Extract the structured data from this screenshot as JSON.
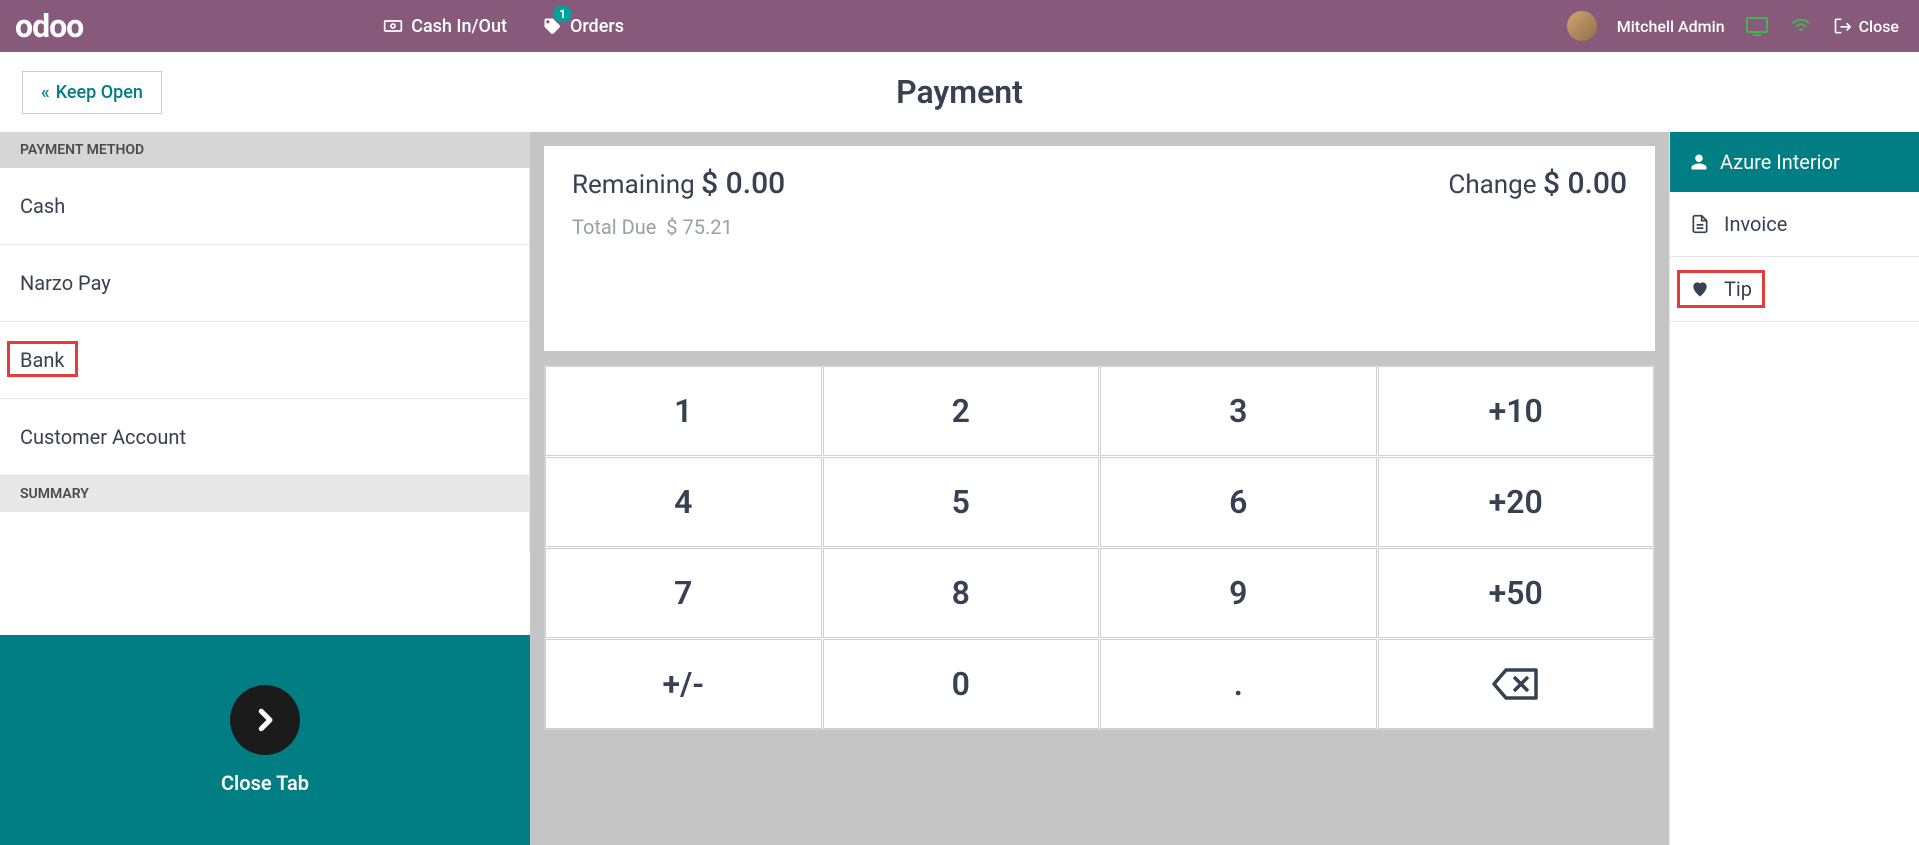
{
  "header": {
    "logo": "odoo",
    "cash_label": "Cash In/Out",
    "orders_label": "Orders",
    "orders_badge": "1",
    "user_name": "Mitchell Admin",
    "close_label": "Close"
  },
  "toolbar": {
    "keep_open_label": "Keep Open",
    "page_title": "Payment"
  },
  "left": {
    "method_header": "PAYMENT METHOD",
    "methods": [
      {
        "label": "Cash",
        "highlighted": false
      },
      {
        "label": "Narzo Pay",
        "highlighted": false
      },
      {
        "label": "Bank",
        "highlighted": true
      },
      {
        "label": "Customer Account",
        "highlighted": false
      }
    ],
    "summary_header": "SUMMARY",
    "validate_label": "Close Tab"
  },
  "center": {
    "remaining_label": "Remaining",
    "remaining_value": "$ 0.00",
    "change_label": "Change",
    "change_value": "$ 0.00",
    "total_due_label": "Total Due",
    "total_due_value": "$ 75.21",
    "numpad": [
      [
        "1",
        "2",
        "3",
        "+10"
      ],
      [
        "4",
        "5",
        "6",
        "+20"
      ],
      [
        "7",
        "8",
        "9",
        "+50"
      ],
      [
        "+/-",
        "0",
        ".",
        "⌫"
      ]
    ]
  },
  "right": {
    "customer_name": "Azure Interior",
    "invoice_label": "Invoice",
    "tip_label": "Tip"
  }
}
